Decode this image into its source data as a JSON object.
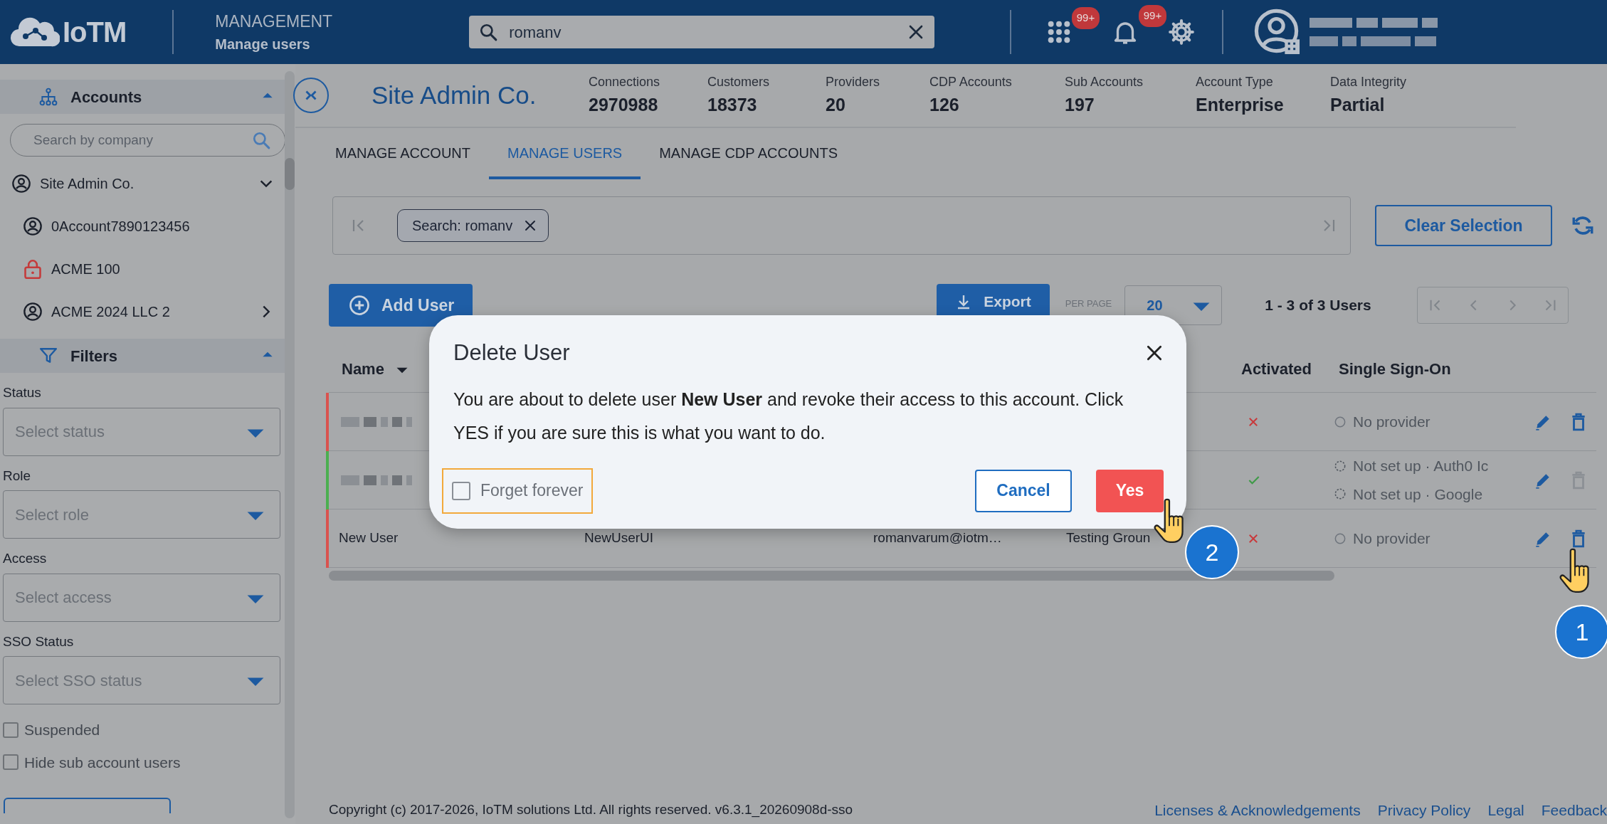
{
  "topbar": {
    "logo_text": "IoTM",
    "section": "MANAGEMENT",
    "page": "Manage users",
    "search": {
      "value": "romanv"
    },
    "apps_badge": "99+",
    "notifications_badge": "99+",
    "user_blurred": true
  },
  "sidebar": {
    "accounts": {
      "title": "Accounts",
      "expanded": true,
      "search": {
        "placeholder": "Search by company"
      },
      "tree": [
        {
          "label": "Site Admin Co.",
          "kind": "account",
          "expanded": true,
          "children": [
            {
              "label": "0Account7890123456",
              "kind": "account"
            },
            {
              "label": "ACME 100",
              "kind": "locked"
            },
            {
              "label": "ACME 2024 LLC 2",
              "kind": "account",
              "expanded": false
            }
          ]
        }
      ]
    },
    "filters": {
      "title": "Filters",
      "expanded": true,
      "selects": [
        {
          "label": "Status",
          "placeholder": "Select status"
        },
        {
          "label": "Role",
          "placeholder": "Select role"
        },
        {
          "label": "Access",
          "placeholder": "Select access"
        },
        {
          "label": "SSO Status",
          "placeholder": "Select SSO status"
        }
      ],
      "checkboxes": [
        {
          "label": "Suspended",
          "checked": false
        },
        {
          "label": "Hide sub account users",
          "checked": false
        }
      ]
    }
  },
  "header": {
    "company": "Site Admin Co.",
    "stats": [
      {
        "label": "Connections",
        "value": "2970988"
      },
      {
        "label": "Customers",
        "value": "18373"
      },
      {
        "label": "Providers",
        "value": "20"
      },
      {
        "label": "CDP Accounts",
        "value": "126"
      },
      {
        "label": "Sub Accounts",
        "value": "197"
      },
      {
        "label": "Account Type",
        "value": "Enterprise"
      },
      {
        "label": "Data Integrity",
        "value": "Partial"
      }
    ]
  },
  "tabs": [
    {
      "label": "MANAGE ACCOUNT",
      "selected": false
    },
    {
      "label": "MANAGE USERS",
      "selected": true
    },
    {
      "label": "MANAGE CDP ACCOUNTS",
      "selected": false
    }
  ],
  "filter_bar": {
    "chips": [
      {
        "label": "Search: romanv"
      }
    ],
    "clear_button": "Clear Selection"
  },
  "toolbar": {
    "add_button": "Add User",
    "export_button": "Export",
    "per_page_label": "PER PAGE",
    "per_page": "20",
    "range": "1 - 3 of 3 Users"
  },
  "table": {
    "header": {
      "name": {
        "label": "Name"
      },
      "activated": {
        "label": "Activated"
      },
      "sso": {
        "label": "Single Sign-On"
      }
    },
    "rows": [
      {
        "color": "#d9534f",
        "name": {
          "blurred": true
        },
        "activated": false,
        "sso": [
          {
            "text": "No provider",
            "kind": "none"
          }
        ],
        "delete_disabled": false
      },
      {
        "color": "#4caf50",
        "name": {
          "blurred": true
        },
        "activated": true,
        "sso": [
          {
            "text": "Not set up · Auth0 Ic",
            "kind": "pending"
          },
          {
            "text": "Not set up · Google",
            "kind": "pending"
          }
        ],
        "delete_disabled": true
      },
      {
        "color": "#d9534f",
        "name": {
          "text": "New User"
        },
        "username": "NewUserUI",
        "email": "romanvarum@iotm…",
        "group": "Testing Groun",
        "activated": false,
        "sso": [
          {
            "text": "No provider",
            "kind": "none"
          }
        ],
        "delete_disabled": false
      }
    ]
  },
  "modal": {
    "title": "Delete User",
    "message": "You are about to delete user **New User** and revoke their access to this account. Click YES if you are sure this is what you want to do.",
    "checkbox": {
      "label": "Forget forever",
      "checked": false,
      "highlighted": true
    },
    "cancel": "Cancel",
    "confirm": "Yes"
  },
  "annotations": [
    {
      "label": "1"
    },
    {
      "label": "2"
    }
  ],
  "footer": {
    "copyright": "Copyright (c) 2017-2026, IoTM solutions Ltd. All rights reserved. v6.3.1_20260908d-sso",
    "links": [
      "Licenses & Acknowledgements",
      "Privacy Policy",
      "Legal",
      "Feedback"
    ]
  }
}
